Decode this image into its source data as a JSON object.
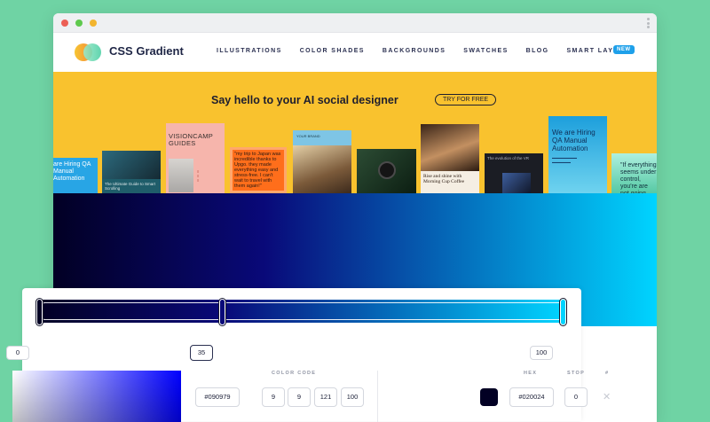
{
  "nav": {
    "brand": "CSS Gradient",
    "menu": [
      "ILLUSTRATIONS",
      "COLOR SHADES",
      "BACKGROUNDS",
      "SWATCHES",
      "BLOG",
      "SMART LAYOUTS"
    ],
    "new_badge": "NEW"
  },
  "banner": {
    "title": "Say hello to your AI social designer",
    "cta": "TRY FOR FREE",
    "cards": [
      "are Hiring QA Manual Automation",
      "The Ultimate Guide to Smart Scrolling",
      "VISIONCAMP GUIDES",
      "\"my trip to Japan was incredible thanks to Upgo. they made everything easy and stress-free. I can't wait to travel with them again!\"",
      "YOUR BRAND",
      "Rise and shine with Morning Cup Coffee",
      "The evolution of the VR",
      "We are Hiring QA Manual Automation",
      "\"If everything seems under control, you're are not going fast enough\""
    ]
  },
  "gradient": {
    "colors": [
      "#020024",
      "#090979",
      "#00d4ff"
    ],
    "stops": [
      0,
      35,
      100
    ]
  },
  "stops": {
    "left": "0",
    "active": "35",
    "right": "100"
  },
  "editor": {
    "color_code_label": "COLOR CODE",
    "hex_label": "HEX",
    "stop_label": "STOP",
    "hash_label": "#",
    "active_hex": "#090979",
    "rgba": [
      "9",
      "9",
      "121",
      "100"
    ],
    "stop_hex": "#020024",
    "stop_value": "0",
    "close": "✕"
  }
}
